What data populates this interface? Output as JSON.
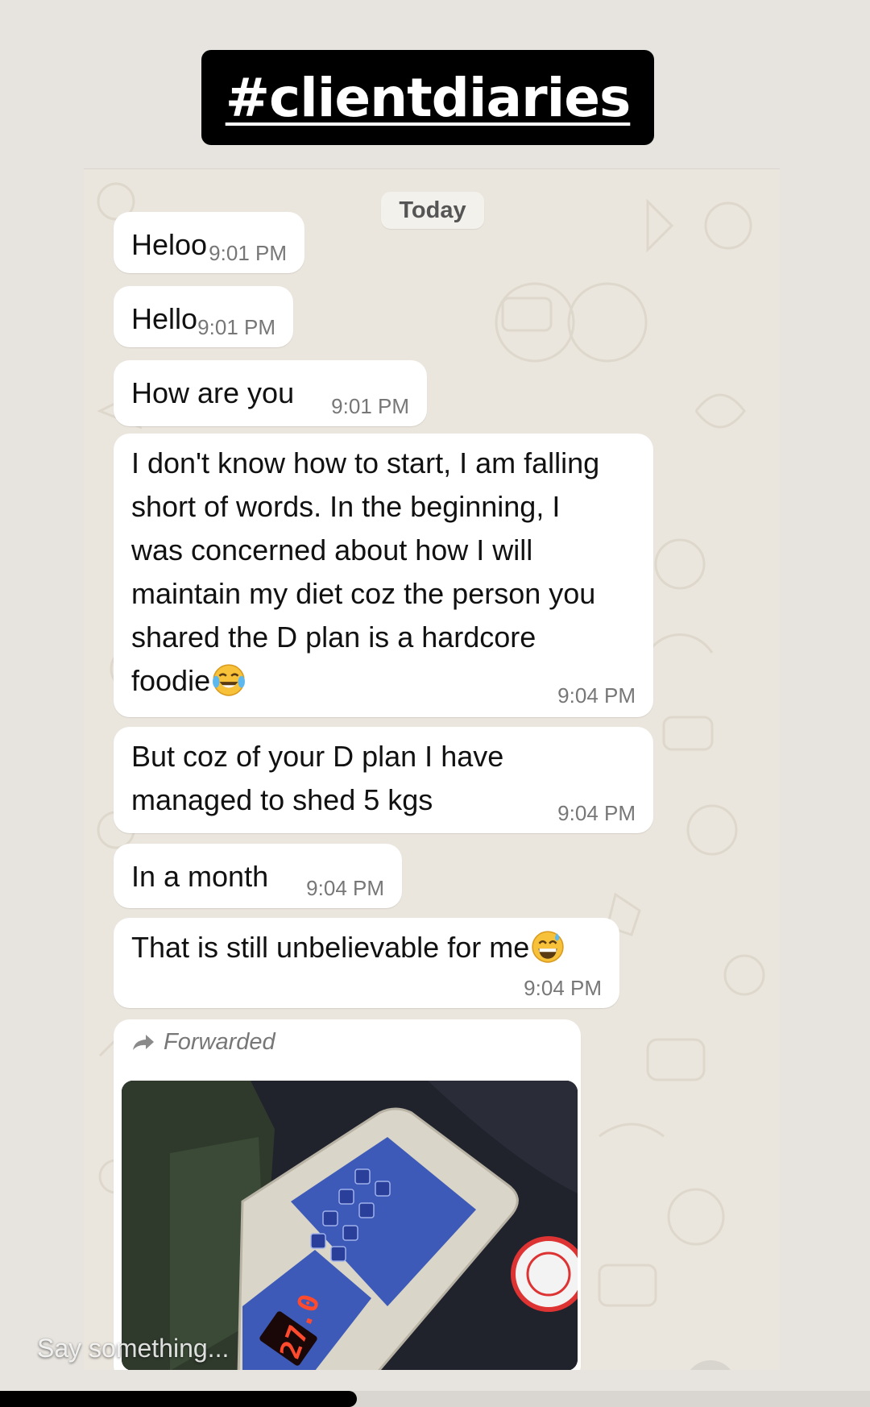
{
  "story": {
    "hashtag": "#clientdiaries",
    "reply_placeholder": "Say something...",
    "progress_fraction": 0.41
  },
  "chat": {
    "date_chip": "Today",
    "messages": [
      {
        "text": "Heloo",
        "time": "9:01 PM"
      },
      {
        "text": "Hello",
        "time": "9:01 PM"
      },
      {
        "text": "How are you",
        "time": "9:01 PM"
      },
      {
        "lines": [
          "I don't know how to start, I am falling",
          "short of words. In the beginning, I",
          "was concerned about how I will",
          "maintain my diet coz the person you",
          "shared the D plan is a hardcore",
          "foodie"
        ],
        "emoji": "face-with-tears-of-joy-icon",
        "time": "9:04 PM"
      },
      {
        "lines": [
          "But coz of your D plan I have",
          "managed to shed 5 kgs"
        ],
        "time": "9:04 PM"
      },
      {
        "text": "In a month",
        "time": "9:04 PM"
      },
      {
        "text": "That is still unbelievable for me",
        "emoji": "grinning-face-with-sweat-icon",
        "time": "9:04 PM"
      }
    ],
    "forwarded": {
      "label": "Forwarded",
      "icon": "forward-arrow-icon",
      "photo": {
        "description_icon": "weighing-scale-photo",
        "display_reading": "27.0"
      }
    }
  },
  "colors": {
    "bubble": "#ffffff",
    "chat_background": "#ebe6dd",
    "timestamp": "#777777",
    "hashtag_background": "#000000"
  }
}
